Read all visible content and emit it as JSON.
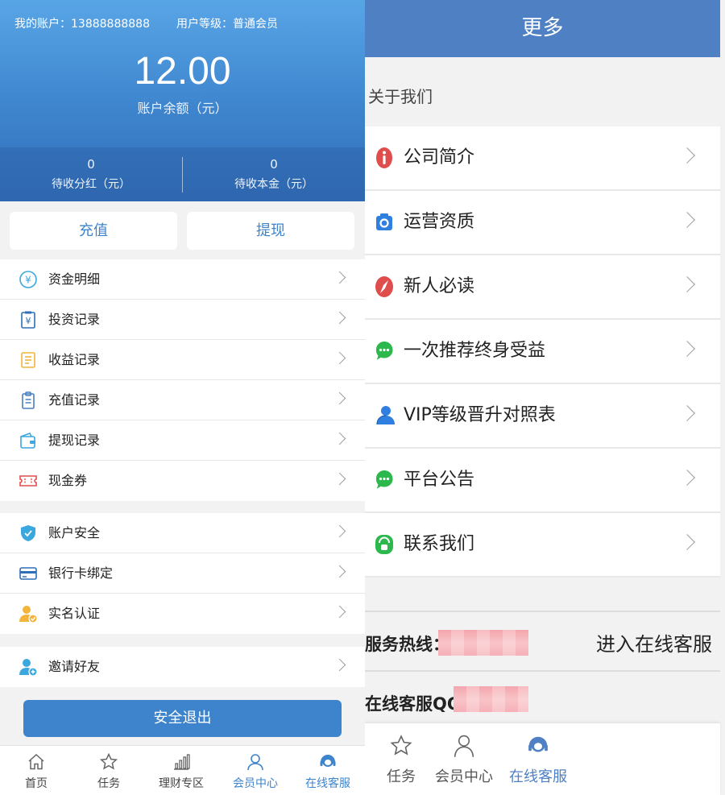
{
  "account": {
    "account_label": "我的账户：13888888888",
    "level_label": "用户等级：普通会员",
    "balance": "12.00",
    "balance_label": "账户余额（元）",
    "stats": [
      {
        "value": "0",
        "label": "待收分红（元）"
      },
      {
        "value": "0",
        "label": "待收本金（元）"
      }
    ]
  },
  "actions": {
    "charge": "充值",
    "withdraw": "提现",
    "logout": "安全退出"
  },
  "menu_groups": [
    [
      {
        "label": "资金明细",
        "icon": "yuan-circle-icon"
      },
      {
        "label": "投资记录",
        "icon": "yuan-receipt-icon"
      },
      {
        "label": "收益记录",
        "icon": "document-icon"
      },
      {
        "label": "充值记录",
        "icon": "clipboard-icon"
      },
      {
        "label": "提现记录",
        "icon": "wallet-icon"
      },
      {
        "label": "现金券",
        "icon": "ticket-icon"
      }
    ],
    [
      {
        "label": "账户安全",
        "icon": "shield-icon"
      },
      {
        "label": "银行卡绑定",
        "icon": "credit-card-icon"
      },
      {
        "label": "实名认证",
        "icon": "verified-user-icon"
      }
    ],
    [
      {
        "label": "邀请好友",
        "icon": "add-user-icon"
      }
    ]
  ],
  "left_tabs": [
    {
      "label": "首页",
      "icon": "home-icon"
    },
    {
      "label": "任务",
      "icon": "star-icon"
    },
    {
      "label": "理财专区",
      "icon": "bar-chart-icon"
    },
    {
      "label": "会员中心",
      "icon": "person-icon"
    },
    {
      "label": "在线客服",
      "icon": "headset-icon"
    }
  ],
  "more": {
    "title": "更多",
    "section": "关于我们",
    "items": [
      {
        "label": "公司简介",
        "icon": "info-icon",
        "color": "#e04d4d"
      },
      {
        "label": "运营资质",
        "icon": "camera-icon",
        "color": "#2f7fe0"
      },
      {
        "label": "新人必读",
        "icon": "compass-icon",
        "color": "#e04d4d"
      },
      {
        "label": "一次推荐终身受益",
        "icon": "chat-bubble-icon",
        "color": "#2db84d"
      },
      {
        "label": "VIP等级晋升对照表",
        "icon": "user-icon",
        "color": "#2f7fe0"
      },
      {
        "label": "平台公告",
        "icon": "chat-bubble-icon",
        "color": "#2db84d"
      },
      {
        "label": "联系我们",
        "icon": "phone-icon",
        "color": "#2db84d"
      }
    ],
    "hotline_label": "服务热线：",
    "online_service_link": "进入在线客服",
    "qq_label": "在线客服QQ："
  },
  "right_tabs": [
    {
      "label": "任务",
      "icon": "star-icon"
    },
    {
      "label": "会员中心",
      "icon": "person-icon"
    },
    {
      "label": "在线客服",
      "icon": "headset-icon"
    }
  ],
  "colors": {
    "primary": "#3d84cd",
    "header": "#4f80c4",
    "accent_red": "#e04d4d",
    "accent_green": "#2db84d"
  }
}
